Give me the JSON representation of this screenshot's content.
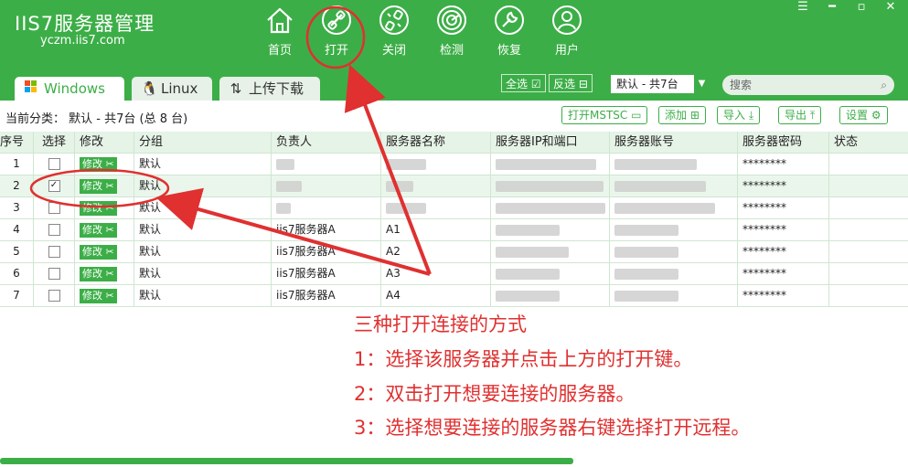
{
  "app": {
    "brand": "IIS7服务器管理",
    "url": "yczm.iis7.com"
  },
  "nav": [
    {
      "label": "首页",
      "icon": "home-icon"
    },
    {
      "label": "打开",
      "icon": "link-icon"
    },
    {
      "label": "关闭",
      "icon": "unlink-icon"
    },
    {
      "label": "检测",
      "icon": "radar-icon"
    },
    {
      "label": "恢复",
      "icon": "wrench-icon"
    },
    {
      "label": "用户",
      "icon": "user-icon"
    }
  ],
  "tabs": [
    {
      "label": "Windows",
      "icon": "windows-icon"
    },
    {
      "label": "Linux",
      "icon": "linux-icon"
    },
    {
      "label": "上传下载",
      "icon": "transfer-icon"
    }
  ],
  "toolbar": {
    "select_all": "全选",
    "invert": "反选",
    "group_selected": "默认 - 共7台",
    "search_placeholder": "搜索"
  },
  "breadcrumb": "当前分类： 默认 - 共7台 (总 8 台)",
  "actions": {
    "open_mstsc": "打开MSTSC",
    "add": "添加",
    "import": "导入",
    "export": "导出",
    "settings": "设置"
  },
  "table": {
    "columns": [
      "序号",
      "选择",
      "修改",
      "分组",
      "负责人",
      "服务器名称",
      "服务器IP和端口",
      "服务器账号",
      "服务器密码",
      "状态"
    ],
    "edit_label": "修改",
    "rows": [
      {
        "no": "1",
        "checked": false,
        "group": "默认",
        "owner": "",
        "name": "",
        "ip": "",
        "account": "",
        "password": "********",
        "status": ""
      },
      {
        "no": "2",
        "checked": true,
        "group": "默认",
        "owner": "",
        "name": "",
        "ip": "",
        "account": "",
        "password": "********",
        "status": ""
      },
      {
        "no": "3",
        "checked": false,
        "group": "默认",
        "owner": "",
        "name": "",
        "ip": "",
        "account": "",
        "password": "********",
        "status": ""
      },
      {
        "no": "4",
        "checked": false,
        "group": "默认",
        "owner": "iis7服务器A",
        "name": "A1",
        "ip": "",
        "account": "",
        "password": "********",
        "status": ""
      },
      {
        "no": "5",
        "checked": false,
        "group": "默认",
        "owner": "iis7服务器A",
        "name": "A2",
        "ip": "",
        "account": "",
        "password": "********",
        "status": ""
      },
      {
        "no": "6",
        "checked": false,
        "group": "默认",
        "owner": "iis7服务器A",
        "name": "A3",
        "ip": "",
        "account": "",
        "password": "********",
        "status": ""
      },
      {
        "no": "7",
        "checked": false,
        "group": "默认",
        "owner": "iis7服务器A",
        "name": "A4",
        "ip": "",
        "account": "",
        "password": "********",
        "status": ""
      }
    ]
  },
  "annotation": {
    "lines": [
      "三种打开连接的方式",
      "1：选择该服务器并点击上方的打开键。",
      "2：双击打开想要连接的服务器。",
      "3：选择想要连接的服务器右键选择打开远程。"
    ],
    "color": "#e03030"
  },
  "colors": {
    "accent": "#3cae47",
    "annotation": "#e03030"
  }
}
